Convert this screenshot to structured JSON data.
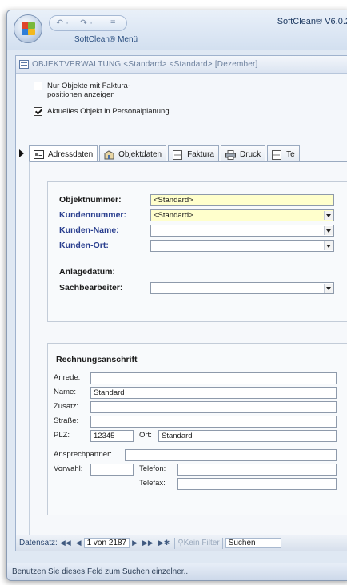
{
  "window": {
    "title": "SoftClean® V6.0.2",
    "menu_label": "SoftClean® Menü",
    "qat_undo": "↶ ·",
    "qat_redo": "↷ ·",
    "qat_more": "="
  },
  "document": {
    "title": "OBJEKTVERWALTUNG  <Standard>  <Standard>  [Dezember]",
    "options": [
      {
        "label_line1": "Nur Objekte mit Faktura-",
        "label_line2": "positionen anzeigen",
        "checked": false
      },
      {
        "label_line1": "Aktuelles Objekt in Personalplanung",
        "label_line2": "",
        "checked": true
      }
    ]
  },
  "tabs": [
    {
      "label": "Adressdaten",
      "active": true
    },
    {
      "label": "Objektdaten",
      "active": false
    },
    {
      "label": "Faktura",
      "active": false
    },
    {
      "label": "Druck",
      "active": false
    },
    {
      "label": "Te",
      "active": false
    }
  ],
  "object_group": {
    "objektnummer_label": "Objektnummer:",
    "objektnummer_value": "<Standard>",
    "kundennummer_label": "Kundennummer:",
    "kundennummer_value": "<Standard>",
    "kunden_name_label": "Kunden-Name:",
    "kunden_name_value": "",
    "kunden_ort_label": "Kunden-Ort:",
    "kunden_ort_value": "",
    "anlagedatum_label": "Anlagedatum:",
    "sachbearbeiter_label": "Sachbearbeiter:",
    "sachbearbeiter_value": ""
  },
  "billing": {
    "heading": "Rechnungsanschrift",
    "anrede_label": "Anrede:",
    "anrede_value": "",
    "name_label": "Name:",
    "name_value": "Standard",
    "zusatz_label": "Zusatz:",
    "zusatz_value": "",
    "strasse_label": "Straße:",
    "strasse_value": "",
    "plz_label": "PLZ:",
    "plz_value": "12345",
    "ort_label": "Ort:",
    "ort_value": "Standard",
    "ansprechpartner_label": "Ansprechpartner:",
    "ansprechpartner_value": "",
    "vorwahl_label": "Vorwahl:",
    "vorwahl_value": "",
    "telefon_label": "Telefon:",
    "telefon_value": "",
    "telefax_label": "Telefax:",
    "telefax_value": ""
  },
  "navigation": {
    "label": "Datensatz:",
    "first": "◀◀",
    "prev": "◀",
    "position": "1 von 2187",
    "next": "▶",
    "last": "▶▶",
    "new": "▶✱",
    "filter_label": "Kein Filter",
    "search_label": "Suchen"
  },
  "statusbar": {
    "text": "Benutzen Sie dieses Feld zum Suchen einzelner..."
  }
}
